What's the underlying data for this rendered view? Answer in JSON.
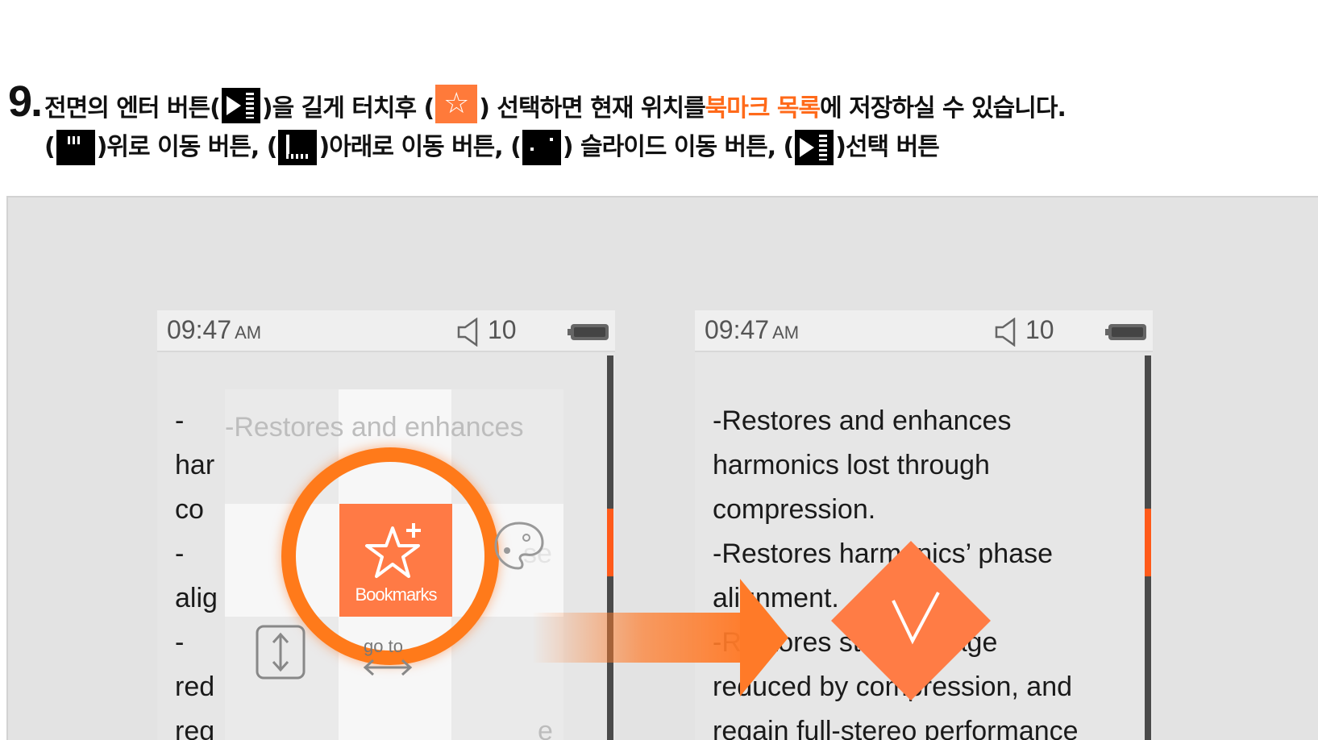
{
  "instruction": {
    "step_number": "9.",
    "line1": {
      "part1": "전면의 엔터 버튼(",
      "part2": ")을 길게 터치후 (",
      "part3": ") 선택하면 현재 위치를 ",
      "highlight": "북마크 목록",
      "part4": "에 저장하실 수 있습니다."
    },
    "line2": {
      "open1": "(",
      "up_text": ")위로 이동 버튼, (",
      "down_text": ")아래로 이동 버튼, (",
      "slide_text": ") 슬라이드 이동 버튼, (",
      "select_text": ")선택 버튼"
    },
    "icons": [
      "enter-button-icon",
      "bookmark-star-icon",
      "up-button-icon",
      "down-button-icon",
      "slide-button-icon"
    ]
  },
  "phones": {
    "status": {
      "time": "09:47",
      "ampm": "AM",
      "volume": "10"
    },
    "reader_lines": [
      "    -Restores and enhances",
      "harmonics lost through",
      "compression.",
      "    -Restores harmonics’ phase",
      "alignment.",
      "    -Restores stereo image",
      "reduced by compression, and",
      "regain full-stereo performance"
    ],
    "left_lines_cut": [
      "    -",
      "har",
      "co",
      "    -",
      "alig",
      "    -",
      "red",
      "reg"
    ],
    "left_tail": {
      "row4": "se",
      "row8": "e"
    },
    "menu": {
      "bookmark_label": "Bookmarks",
      "goto_label": "go to"
    }
  },
  "colors": {
    "accent": "#ff7a28",
    "highlight_text": "#ff6a1a",
    "panel_bg": "#e3e3e3",
    "scroll_thumb": "#ff5a1a"
  }
}
